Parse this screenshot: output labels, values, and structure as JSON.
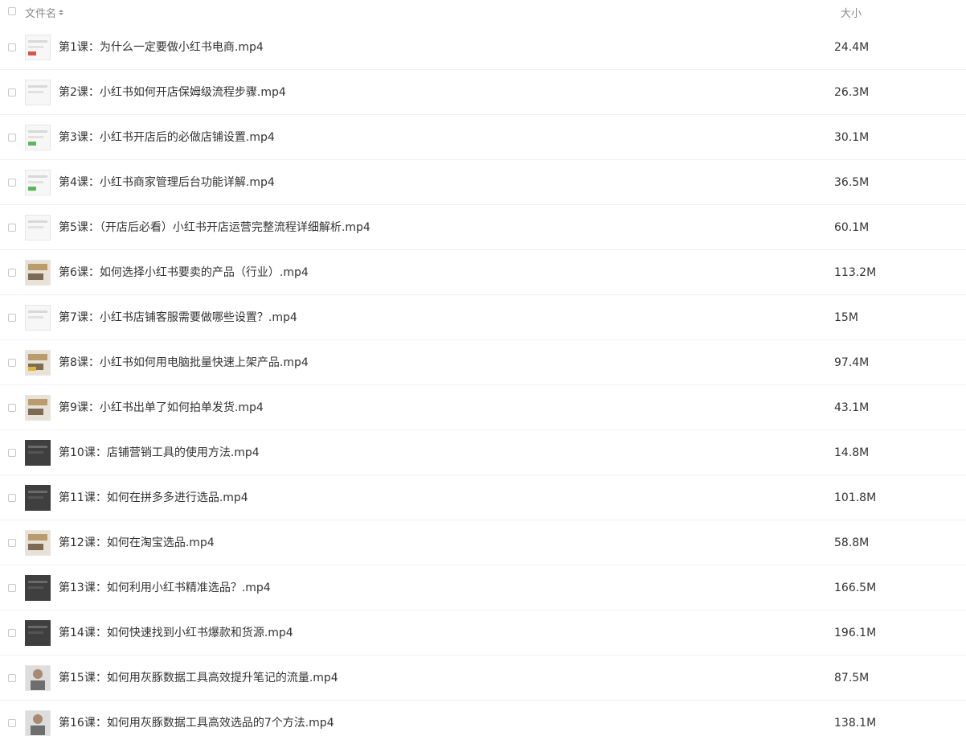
{
  "header": {
    "name_label": "文件名",
    "size_label": "大小"
  },
  "files": [
    {
      "name": "第1课：为什么一定要做小红书电商.mp4",
      "size": "24.4M",
      "thumb": "light-red-thumbnail"
    },
    {
      "name": "第2课：小红书如何开店保姆级流程步骤.mp4",
      "size": "26.3M",
      "thumb": "light-thumbnail"
    },
    {
      "name": "第3课：小红书开店后的必做店铺设置.mp4",
      "size": "30.1M",
      "thumb": "light-green-thumbnail"
    },
    {
      "name": "第4课：小红书商家管理后台功能详解.mp4",
      "size": "36.5M",
      "thumb": "light-green-thumbnail"
    },
    {
      "name": "第5课：（开店后必看）小红书开店运营完整流程详细解析.mp4",
      "size": "60.1M",
      "thumb": "light-thumbnail"
    },
    {
      "name": "第6课：如何选择小红书要卖的产品（行业）.mp4",
      "size": "113.2M",
      "thumb": "photo-thumbnail"
    },
    {
      "name": "第7课：小红书店铺客服需要做哪些设置？.mp4",
      "size": "15M",
      "thumb": "light-thumbnail"
    },
    {
      "name": "第8课：小红书如何用电脑批量快速上架产品.mp4",
      "size": "97.4M",
      "thumb": "photo-yellow-thumbnail"
    },
    {
      "name": "第9课：小红书出单了如何拍单发货.mp4",
      "size": "43.1M",
      "thumb": "photo-thumbnail"
    },
    {
      "name": "第10课：店铺营销工具的使用方法.mp4",
      "size": "14.8M",
      "thumb": "dark-thumbnail"
    },
    {
      "name": "第11课：如何在拼多多进行选品.mp4",
      "size": "101.8M",
      "thumb": "dark-thumbnail"
    },
    {
      "name": "第12课：如何在淘宝选品.mp4",
      "size": "58.8M",
      "thumb": "photo-thumbnail"
    },
    {
      "name": "第13课：如何利用小红书精准选品？.mp4",
      "size": "166.5M",
      "thumb": "dark-thumbnail"
    },
    {
      "name": "第14课：如何快速找到小红书爆款和货源.mp4",
      "size": "196.1M",
      "thumb": "dark-thumbnail"
    },
    {
      "name": "第15课：如何用灰豚数据工具高效提升笔记的流量.mp4",
      "size": "87.5M",
      "thumb": "face-thumbnail"
    },
    {
      "name": "第16课：如何用灰豚数据工具高效选品的7个方法.mp4",
      "size": "138.1M",
      "thumb": "face-thumbnail"
    }
  ],
  "colors": {
    "text": "#333333",
    "header_text": "#8a8a8a",
    "divider": "#f0f0f0",
    "accent_red": "#d9534f",
    "accent_green": "#5cb85c",
    "accent_yellow": "#e0b63a"
  }
}
